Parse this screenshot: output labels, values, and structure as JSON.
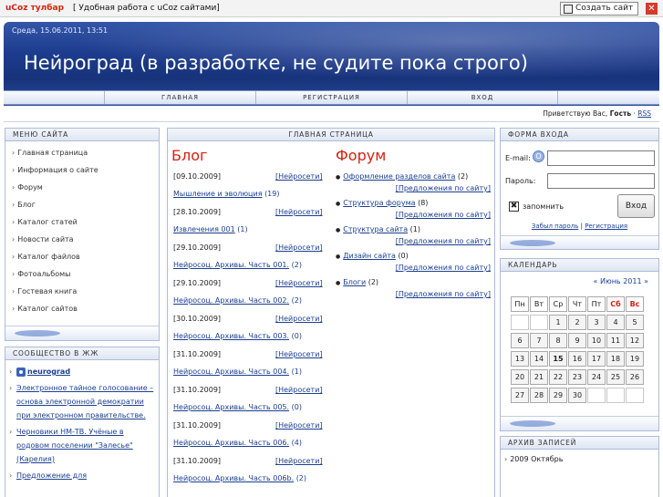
{
  "toolbar": {
    "brand": "uCoz тулбар",
    "slogan": "[ Удобная работа с uCoz сайтами]",
    "create_label": "Создать сайт",
    "close": "✕"
  },
  "header": {
    "date": "Среда, 15.06.2011, 13:51",
    "title": "Нейроград (в разработке, не судите пока строго)",
    "nav": [
      "ГЛАВНАЯ",
      "РЕГИСТРАЦИЯ",
      "ВХОД"
    ],
    "greeting_prefix": "Приветствую Вас, ",
    "greeting_user": "Гость",
    "greeting_sep": " · ",
    "rss": "RSS"
  },
  "site_menu": {
    "title": "МЕНЮ САЙТА",
    "items": [
      "Главная страница",
      "Информация о сайте",
      "Форум",
      "Блог",
      "Каталог статей",
      "Новости сайта",
      "Каталог файлов",
      "Фотоальбомы",
      "Гостевая книга",
      "Каталог сайтов"
    ]
  },
  "community": {
    "title": "СООБЩЕСТВО В ЖЖ",
    "user": "neurograd",
    "items": [
      "Электронное тайное голосование – основа электронной демократии при электронном правительстве.",
      "Черновики НМ-ТВ. Учёные в родовом поселении \"Залесье\" (Карелия)",
      "Предложение для"
    ]
  },
  "main": {
    "title": "ГЛАВНАЯ СТРАНИЦА",
    "blog_title": "Блог",
    "blog": [
      {
        "date": "[09.10.2009]",
        "category": "[Нейросети]",
        "title": "Мышление и эволюция",
        "comments": "(19)",
        "count": "19"
      },
      {
        "date": "[28.10.2009]",
        "category": "[Нейросети]",
        "title": "Извлечения 001",
        "comments": "(1)",
        "count": "1"
      },
      {
        "date": "[29.10.2009]",
        "category": "[Нейросети]",
        "title": "Нейросоц. Архивы. Часть 001.",
        "comments": "(2)",
        "count": "2"
      },
      {
        "date": "[29.10.2009]",
        "category": "[Нейросети]",
        "title": "Нейросоц. Архивы. Часть 002.",
        "comments": "(2)",
        "count": "2"
      },
      {
        "date": "[30.10.2009]",
        "category": "[Нейросети]",
        "title": "Нейросоц. Архивы. Часть 003.",
        "comments": "(0)",
        "count": "0"
      },
      {
        "date": "[31.10.2009]",
        "category": "[Нейросети]",
        "title": "Нейросоц. Архивы. Часть 004.",
        "comments": "(1)",
        "count": "1"
      },
      {
        "date": "[31.10.2009]",
        "category": "[Нейросети]",
        "title": "Нейросоц. Архивы. Часть 005.",
        "comments": "(0)",
        "count": "0"
      },
      {
        "date": "[31.10.2009]",
        "category": "[Нейросети]",
        "title": "Нейросоц. Архивы. Часть 006.",
        "comments": "(4)",
        "count": "4"
      },
      {
        "date": "[31.10.2009]",
        "category": "[Нейросети]",
        "title": "Нейросоц. Архивы. Часть 006b.",
        "comments": "(2)",
        "count": "2"
      }
    ],
    "forum_title": "Форум",
    "forum": [
      {
        "title": "Оформление разделов сайта",
        "count": "(2)",
        "section": "[Предложения по сайту]"
      },
      {
        "title": "Структура форума",
        "count": "(8)",
        "section": "[Предложения по сайту]"
      },
      {
        "title": "Структура сайта",
        "count": "(1)",
        "section": "[Предложения по сайту]"
      },
      {
        "title": "Дизайн сайта",
        "count": "(0)",
        "section": "[Предложения по сайту]"
      },
      {
        "title": "Блоги",
        "count": "(2)",
        "section": "[Предложения по сайту]"
      }
    ]
  },
  "login": {
    "title": "ФОРМА ВХОДА",
    "email_label": "E-mail:",
    "password_label": "Пароль:",
    "remember": "запомнить",
    "remember_checked": true,
    "submit": "Вход",
    "forgot": "Забыл пароль",
    "separator": " | ",
    "register": "Регистрация"
  },
  "calendar": {
    "title": "КАЛЕНДАРЬ",
    "month": "« Июнь 2011 »",
    "weekdays": [
      "Пн",
      "Вт",
      "Ср",
      "Чт",
      "Пт",
      "Сб",
      "Вс"
    ],
    "weeks": [
      [
        "",
        "",
        "1",
        "2",
        "3",
        "4",
        "5"
      ],
      [
        "6",
        "7",
        "8",
        "9",
        "10",
        "11",
        "12"
      ],
      [
        "13",
        "14",
        "15",
        "16",
        "17",
        "18",
        "19"
      ],
      [
        "20",
        "21",
        "22",
        "23",
        "24",
        "25",
        "26"
      ],
      [
        "27",
        "28",
        "29",
        "30",
        "",
        "",
        ""
      ]
    ],
    "today": "15"
  },
  "archive": {
    "title": "АРХИВ ЗАПИСЕЙ",
    "items": [
      "2009 Октябрь"
    ]
  },
  "colors": {
    "accent": "#d8200e",
    "link": "#1b3f91",
    "header": "#1d3c8e"
  }
}
